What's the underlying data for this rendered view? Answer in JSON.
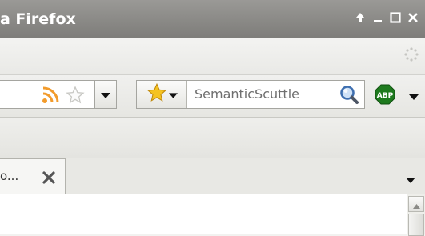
{
  "window": {
    "title": "a Firefox",
    "buttons": [
      "up-icon",
      "minimize-icon",
      "maximize-icon",
      "close-icon"
    ]
  },
  "navbar": {
    "feed_icon": "rss-feed-icon",
    "bookmark_star_icon": "star-outline-icon",
    "search": {
      "engine_icon": "star-yellow-icon",
      "engine_name": "SemanticScuttle",
      "go_icon": "magnifier-icon"
    },
    "addon": {
      "label": "ABP",
      "color": "#1e7a1e"
    }
  },
  "tabs": [
    {
      "title": "o...",
      "close_icon": "close-icon"
    }
  ],
  "colors": {
    "titlebar": "#8b8a87",
    "feed": "#f29b2c",
    "star": "#f5c320"
  }
}
